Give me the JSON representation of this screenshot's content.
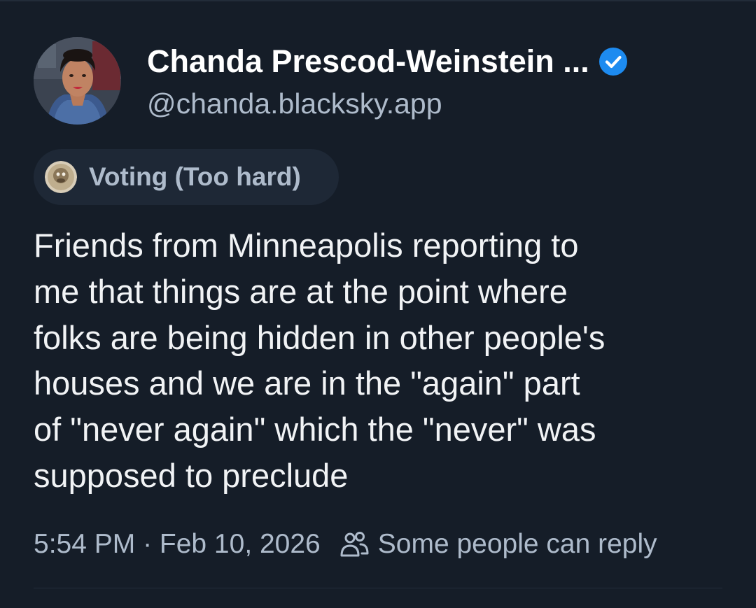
{
  "author": {
    "display_name": "Chanda Prescod-Weinstein ...",
    "handle": "@chanda.blacksky.app",
    "verified": true,
    "avatar_icon": "user-avatar"
  },
  "label": {
    "text": "Voting (Too hard)",
    "icon": "label-labeler-avatar"
  },
  "post": {
    "lines": [
      "Friends from Minneapolis reporting to",
      "me that things are at the point where",
      "folks are being hidden in other people's",
      "houses and we are in the \"again\" part",
      "of \"never again\" which the \"never\" was",
      "supposed to preclude"
    ]
  },
  "meta": {
    "timestamp": "5:54 PM · Feb 10, 2026",
    "reply_icon": "people-icon",
    "reply_setting": "Some people can reply"
  },
  "colors": {
    "background": "#151d28",
    "verified": "#1d8bf0",
    "muted_text": "#aebbcb",
    "chip_background": "#1e2836"
  }
}
